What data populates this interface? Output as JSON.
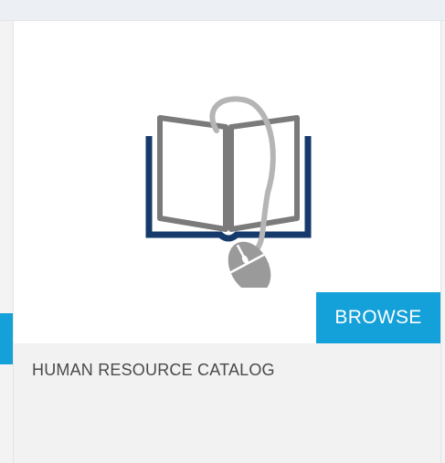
{
  "card": {
    "title": "HUMAN RESOURCE CATALOG",
    "browse_label": "BROWSE",
    "icon": "book-with-mouse-icon"
  },
  "colors": {
    "accent": "#14a0d9",
    "book_outline": "#7b7b7b",
    "book_base": "#163a6b",
    "mouse": "#9a9a9a",
    "footer_bg": "#f2f2f2",
    "title_text": "#4a4a4a"
  }
}
